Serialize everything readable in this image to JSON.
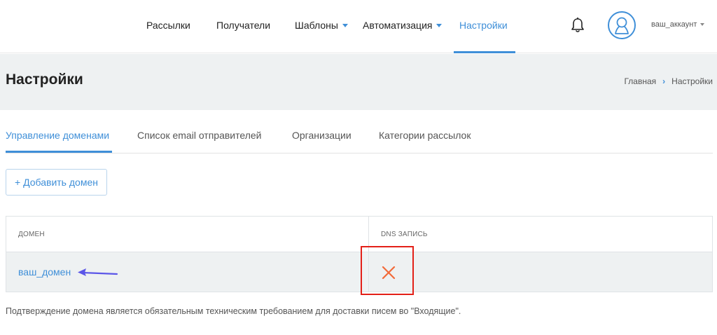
{
  "nav": {
    "items": [
      {
        "label": "Рассылки"
      },
      {
        "label": "Получатели"
      },
      {
        "label": "Шаблоны"
      },
      {
        "label": "Автоматизация"
      },
      {
        "label": "Настройки"
      }
    ],
    "account": "ваш_аккаунт",
    "icons": {
      "bell": "bell-icon",
      "avatar": "user-avatar-icon"
    }
  },
  "header": {
    "title": "Настройки",
    "breadcrumb": [
      "Главная",
      "Настройки"
    ],
    "breadcrumb_separator": "›"
  },
  "tabs": [
    {
      "label": "Управление доменами",
      "active": true
    },
    {
      "label": "Список email отправителей",
      "active": false
    },
    {
      "label": "Организации",
      "active": false
    },
    {
      "label": "Категории рассылок",
      "active": false
    }
  ],
  "actions": {
    "add_domain": "+ Добавить домен"
  },
  "table": {
    "columns": [
      "Домен",
      "DNS запись"
    ],
    "rows": [
      {
        "domain": "ваш_домен",
        "dns_status": "not-verified",
        "dns_icon": "x-icon"
      }
    ]
  },
  "note": "Подтверждение домена является обязательным техническим требованием для доставки писем во \"Входящие\".",
  "colors": {
    "accent": "#3f8fd8",
    "header_band": "#eef1f2",
    "error": "#f26b3a",
    "annotation_box": "#e32018",
    "annotation_arrow": "#5b56e8"
  }
}
